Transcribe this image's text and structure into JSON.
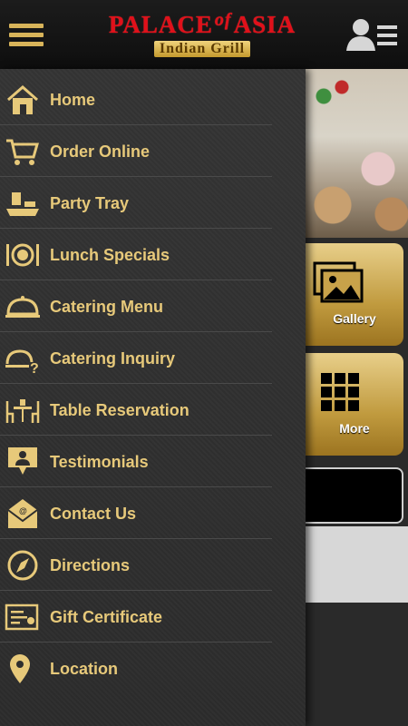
{
  "header": {
    "logo_main_left": "PALACE",
    "logo_of": "of",
    "logo_main_right": "ASIA",
    "logo_sub": "Indian Grill",
    "menu_icon": "hamburger-menu-icon",
    "profile_icon": "user-menu-icon"
  },
  "colors": {
    "accent_gold": "#e7c97a",
    "brand_red": "#e0101a",
    "drawer_bg": "#2e2e2e"
  },
  "menu": {
    "items": [
      {
        "label": "Home",
        "icon": "home-icon"
      },
      {
        "label": "Order Online",
        "icon": "cart-icon"
      },
      {
        "label": "Party Tray",
        "icon": "party-tray-icon"
      },
      {
        "label": "Lunch Specials",
        "icon": "plate-cutlery-icon"
      },
      {
        "label": "Catering Menu",
        "icon": "cloche-icon"
      },
      {
        "label": "Catering Inquiry",
        "icon": "cloche-question-icon"
      },
      {
        "label": "Table Reservation",
        "icon": "table-chairs-icon"
      },
      {
        "label": "Testimonials",
        "icon": "testimonial-icon"
      },
      {
        "label": "Contact Us",
        "icon": "envelope-icon"
      },
      {
        "label": "Directions",
        "icon": "compass-icon"
      },
      {
        "label": "Gift Certificate",
        "icon": "certificate-icon"
      },
      {
        "label": "Location",
        "icon": "location-pin-icon"
      }
    ]
  },
  "tiles": {
    "gallery_label": "Gallery",
    "more_label": "More"
  }
}
